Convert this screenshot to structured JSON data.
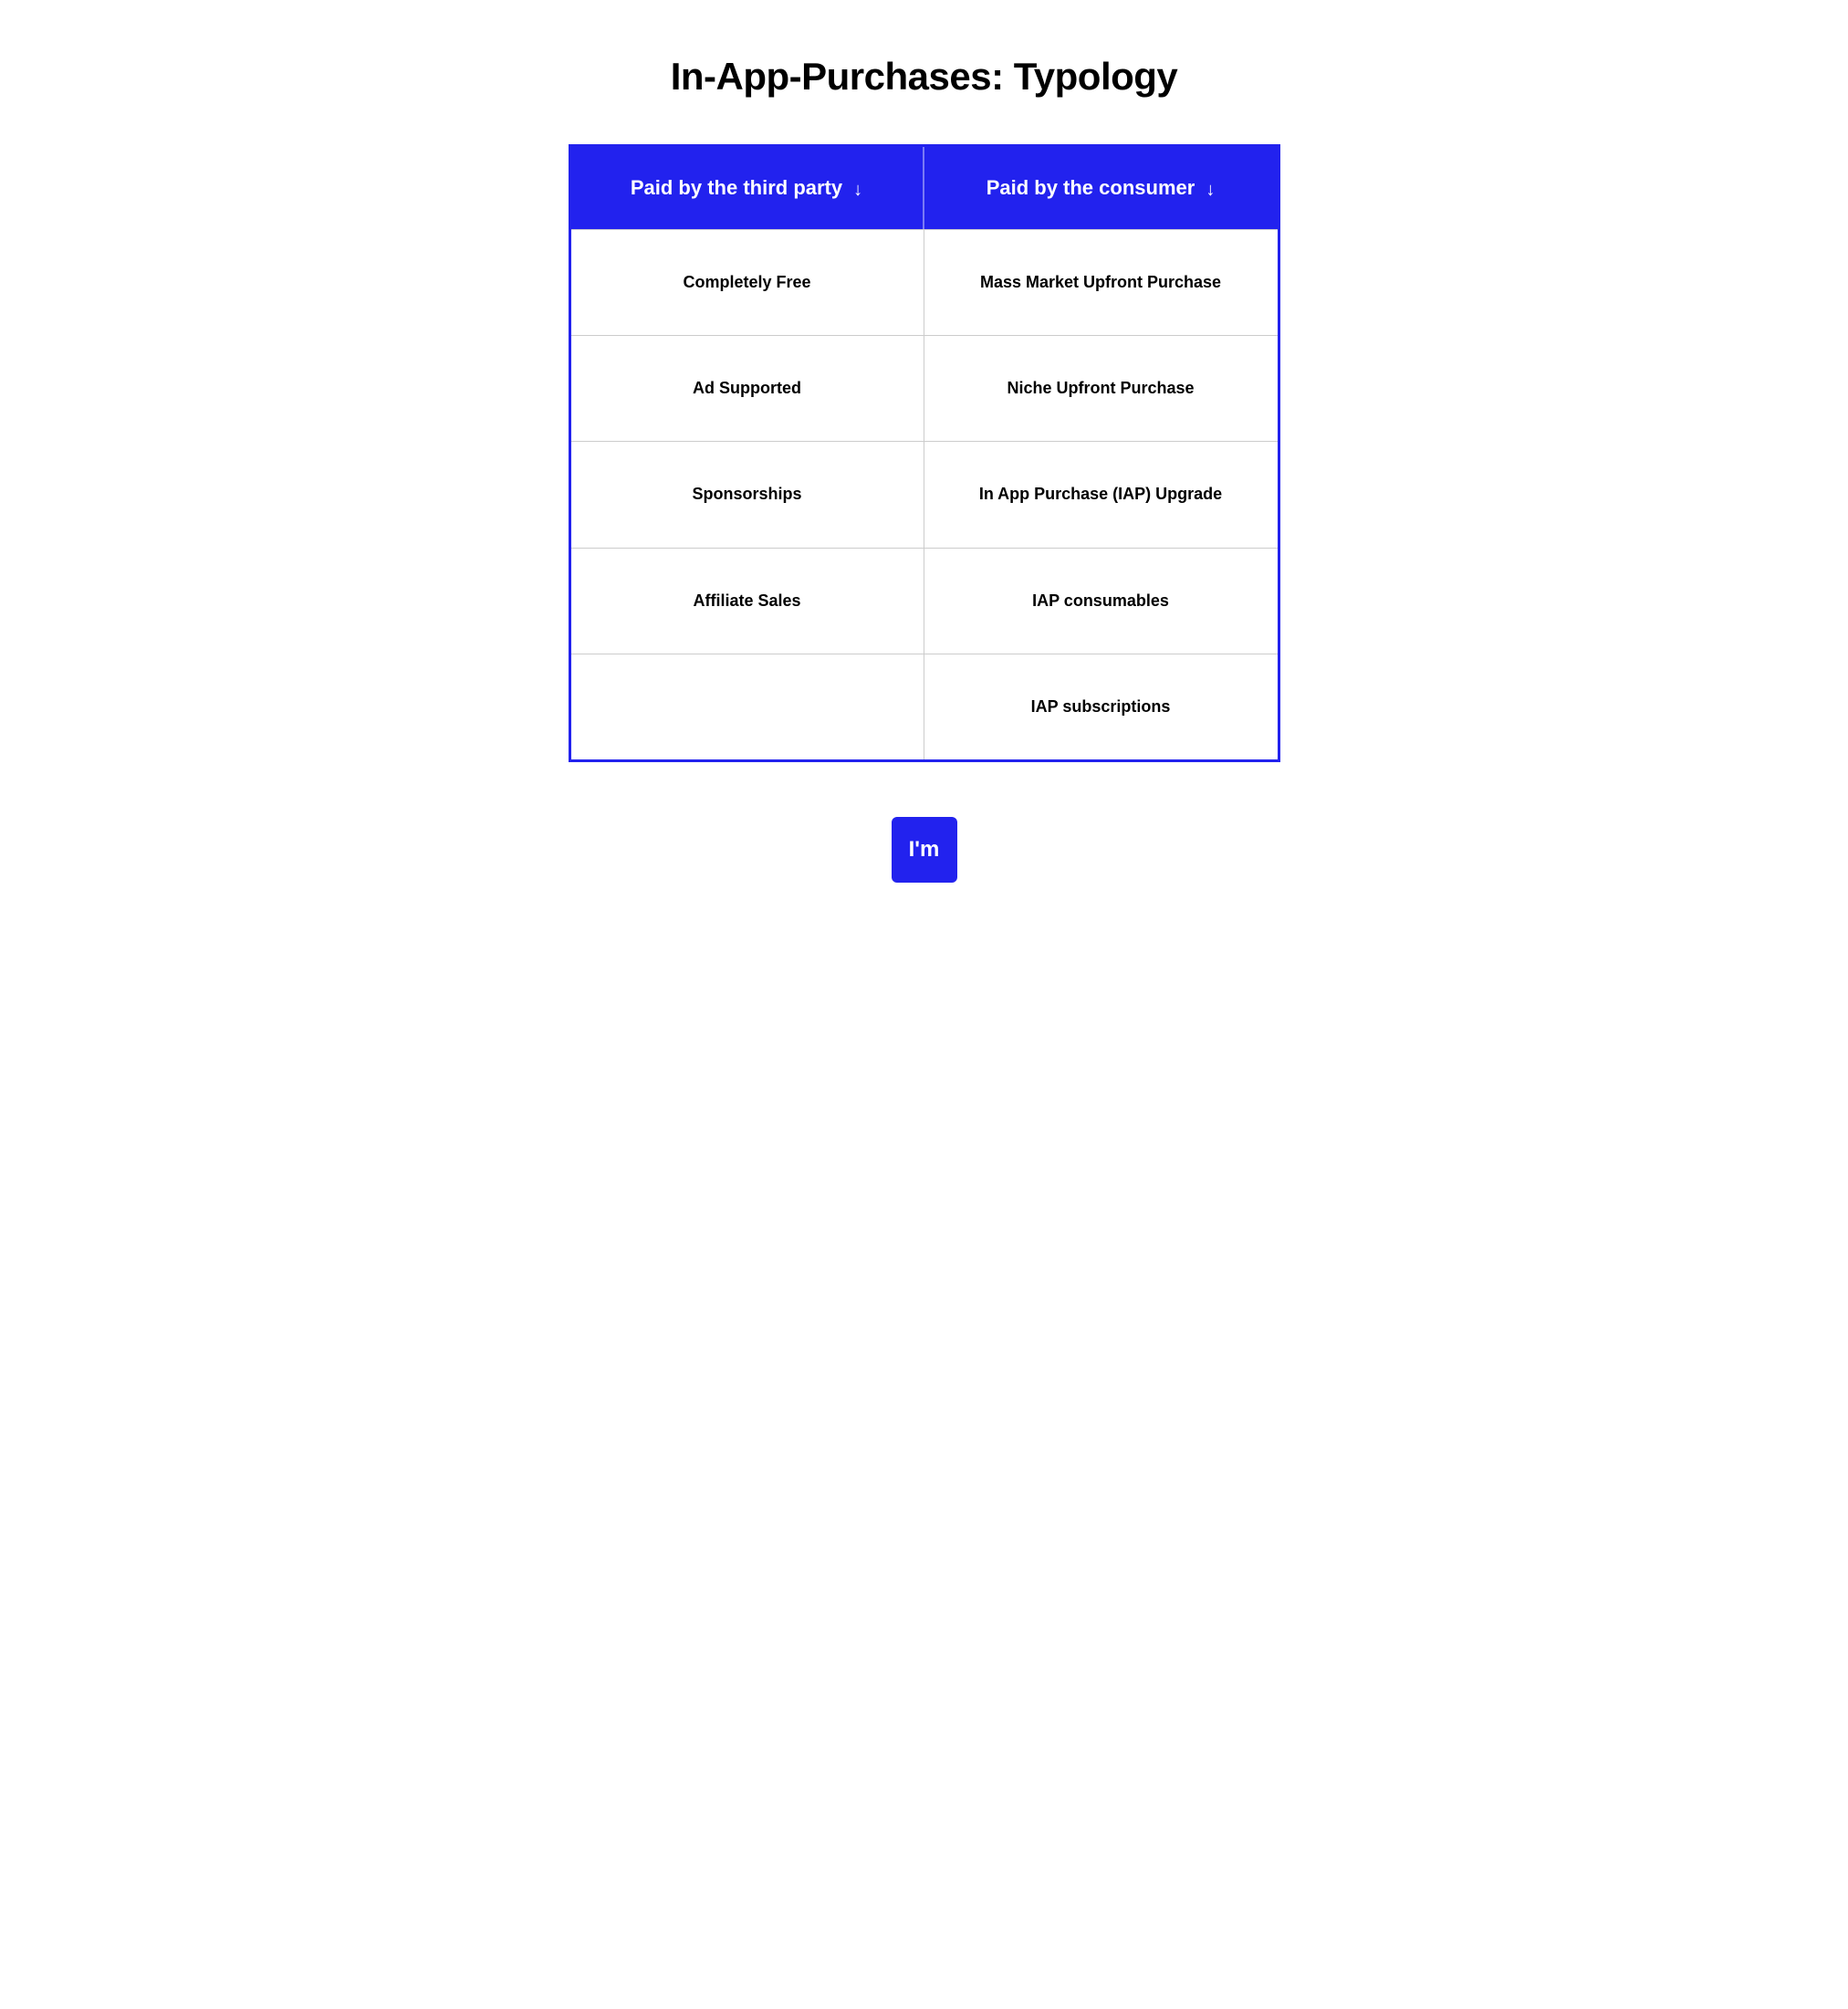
{
  "page": {
    "title": "In-App-Purchases: Typology"
  },
  "table": {
    "headers": [
      {
        "label": "Paid by the third party",
        "arrow": "↓"
      },
      {
        "label": "Paid by the consumer",
        "arrow": "↓"
      }
    ],
    "rows": [
      {
        "left": "Completely Free",
        "right": "Mass Market Upfront Purchase"
      },
      {
        "left": "Ad Supported",
        "right": "Niche Upfront Purchase"
      },
      {
        "left": "Sponsorships",
        "right": "In App Purchase (IAP) Upgrade"
      },
      {
        "left": "Affiliate Sales",
        "right": "IAP consumables"
      },
      {
        "left": "",
        "right": "IAP subscriptions"
      }
    ]
  },
  "logo": {
    "text": "I'm"
  },
  "colors": {
    "accent": "#2222ee",
    "white": "#ffffff",
    "black": "#000000",
    "divider": "#cccccc"
  }
}
